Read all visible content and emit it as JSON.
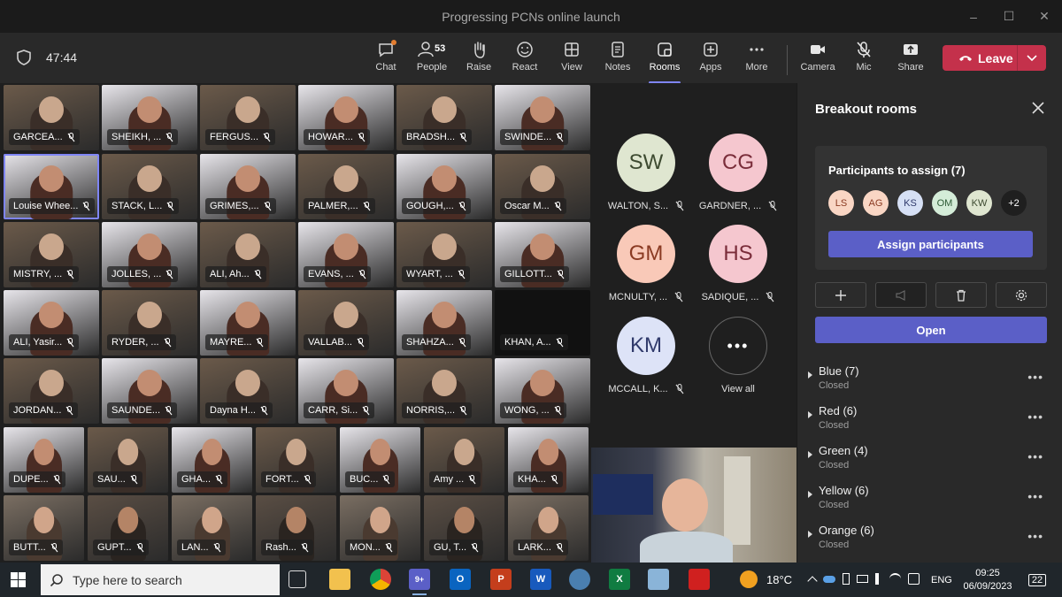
{
  "window": {
    "title": "Progressing PCNs online launch",
    "controls": [
      "–",
      "☐",
      "✕"
    ]
  },
  "meeting": {
    "timer": "47:44",
    "participant_count": "53"
  },
  "toolbar": {
    "items": [
      {
        "label": "Chat",
        "icon": "chat-icon"
      },
      {
        "label": "People",
        "icon": "people-icon"
      },
      {
        "label": "Raise",
        "icon": "hand-icon"
      },
      {
        "label": "React",
        "icon": "smiley-icon"
      },
      {
        "label": "View",
        "icon": "view-icon"
      },
      {
        "label": "Notes",
        "icon": "notes-icon"
      },
      {
        "label": "Rooms",
        "icon": "rooms-icon"
      },
      {
        "label": "Apps",
        "icon": "apps-icon"
      },
      {
        "label": "More",
        "icon": "more-icon"
      },
      {
        "label": "Camera",
        "icon": "camera-icon"
      },
      {
        "label": "Mic",
        "icon": "mic-off-icon"
      },
      {
        "label": "Share",
        "icon": "share-icon"
      }
    ],
    "leave_label": "Leave"
  },
  "tiles": [
    "GARCEA...",
    "SHEIKH, ...",
    "FERGUS...",
    "HOWAR...",
    "BRADSH...",
    "SWINDE...",
    "Louise Whee...",
    "STACK, L...",
    "GRIMES,...",
    "PALMER,...",
    "GOUGH,...",
    "Oscar M...",
    "MISTRY, ...",
    "JOLLES, ...",
    "ALI, Ah...",
    "EVANS, ...",
    "WYART, ...",
    "GILLOTT...",
    "ALI, Yasir...",
    "RYDER, ...",
    "MAYRE...",
    "VALLAB...",
    "SHAHZA...",
    "KHAN, A...",
    "JORDAN...",
    "SAUNDE...",
    "Dayna H...",
    "CARR, Si...",
    "NORRIS,...",
    "WONG, ...",
    "DUPE...",
    "SAU...",
    "GHA...",
    "FORT...",
    "BUC...",
    "Amy ...",
    "KHA...",
    "BUTT...",
    "GUPT...",
    "LAN...",
    "Rash...",
    "MON...",
    "GU, T...",
    "LARK..."
  ],
  "avatars": [
    {
      "initials": "SW",
      "name": "WALTON, S...",
      "bg": "#dfe6d0",
      "fg": "#3d4a30"
    },
    {
      "initials": "CG",
      "name": "GARDNER, ...",
      "bg": "#f5c7cf",
      "fg": "#7a2d3a"
    },
    {
      "initials": "GM",
      "name": "MCNULTY, ...",
      "bg": "#f9c9b8",
      "fg": "#8a3a22"
    },
    {
      "initials": "HS",
      "name": "SADIQUE, ...",
      "bg": "#f5c7cf",
      "fg": "#7a2d3a"
    },
    {
      "initials": "KM",
      "name": "MCCALL, K...",
      "bg": "#dde3f7",
      "fg": "#303a6b"
    }
  ],
  "view_all_label": "View all",
  "breakout": {
    "title": "Breakout rooms",
    "assign_header": "Participants to assign (7)",
    "chips": [
      {
        "initials": "LS",
        "bg": "#f9d6c4",
        "fg": "#8a3a22"
      },
      {
        "initials": "AG",
        "bg": "#f9d6c4",
        "fg": "#8a3a22"
      },
      {
        "initials": "KS",
        "bg": "#d6e0f5",
        "fg": "#303a6b"
      },
      {
        "initials": "OM",
        "bg": "#d4ecd8",
        "fg": "#2d5a35"
      },
      {
        "initials": "KW",
        "bg": "#dfe6d0",
        "fg": "#3d4a30"
      },
      {
        "initials": "+2",
        "bg": "#1f1f1f",
        "fg": "#ffffff"
      }
    ],
    "assign_button": "Assign participants",
    "open_button": "Open",
    "rooms": [
      {
        "name": "Blue  (7)",
        "status": "Closed"
      },
      {
        "name": "Red  (6)",
        "status": "Closed"
      },
      {
        "name": "Green  (4)",
        "status": "Closed"
      },
      {
        "name": "Yellow  (6)",
        "status": "Closed"
      },
      {
        "name": "Orange  (6)",
        "status": "Closed"
      }
    ]
  },
  "taskbar": {
    "search_placeholder": "Type here to search",
    "temperature": "18°C",
    "language": "ENG",
    "time": "09:25",
    "date": "06/09/2023",
    "notifications": "22",
    "teams_badge": "9+"
  }
}
